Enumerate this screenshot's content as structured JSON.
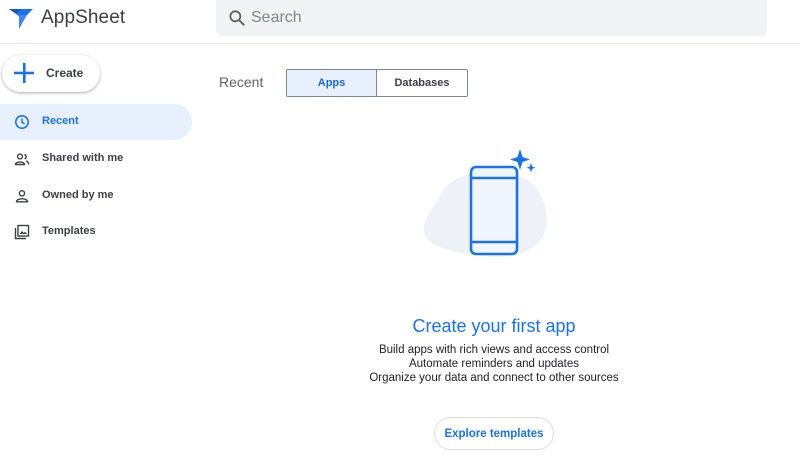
{
  "header": {
    "app_name": "AppSheet",
    "search_placeholder": "Search"
  },
  "sidebar": {
    "create_label": "Create",
    "items": [
      {
        "label": "Recent",
        "icon": "clock-icon",
        "active": true
      },
      {
        "label": "Shared with me",
        "icon": "people-icon",
        "active": false
      },
      {
        "label": "Owned by me",
        "icon": "person-icon",
        "active": false
      },
      {
        "label": "Templates",
        "icon": "templates-icon",
        "active": false
      }
    ]
  },
  "main": {
    "heading": "Recent",
    "tabs": [
      {
        "label": "Apps",
        "selected": true
      },
      {
        "label": "Databases",
        "selected": false
      }
    ],
    "empty_state": {
      "title": "Create your first app",
      "lines": [
        "Build apps with rich views and access control",
        "Automate reminders and updates",
        "Organize your data and connect to other sources"
      ],
      "button_label": "Explore templates"
    }
  },
  "colors": {
    "accent": "#1a73e8",
    "active_bg": "#e8f0fe",
    "text": "#3c4043"
  }
}
